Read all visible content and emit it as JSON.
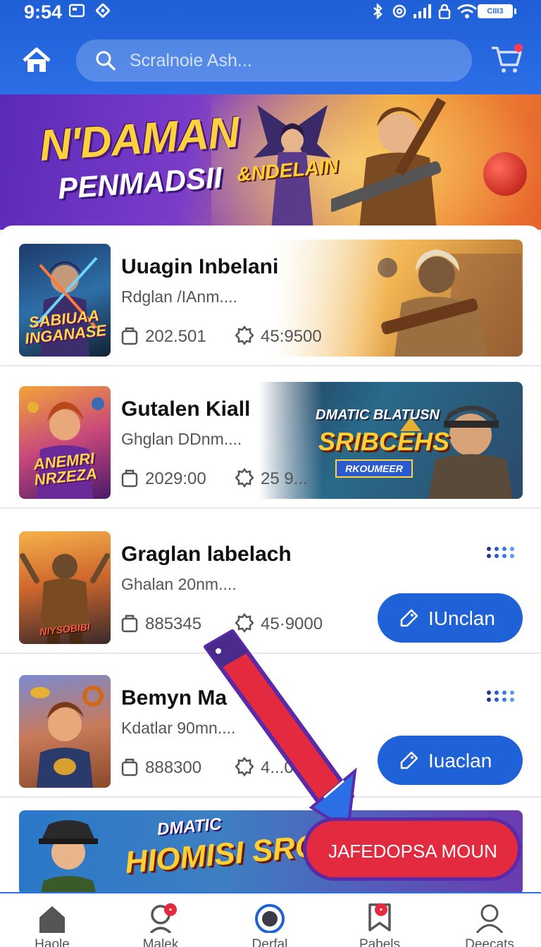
{
  "status_bar": {
    "time": "9:54",
    "battery": "CIII3"
  },
  "search": {
    "placeholder": "Scralnoie Ash..."
  },
  "banner": {
    "title_line1": "N'DAMAN",
    "title_line2": "PENMADSII",
    "badge": "&NDELAIN"
  },
  "items": [
    {
      "title": "Uuagin Inbelani",
      "subtitle": "Rdglan /IAnm....",
      "meta1": "202.501",
      "meta2": "45:9500",
      "thumb_label": "SABIUAA INGANASE"
    },
    {
      "title": "Gutalen Kiall",
      "subtitle": "Ghglan DDnm....",
      "meta1": "2029:00",
      "meta2": "25 9...",
      "thumb_label": "ANEMRI NRZEZA",
      "promo_title": "SRIBCEHS",
      "promo_top": "DMATIC BLATUSN",
      "promo_ribbon": "RKOUMEER"
    },
    {
      "title": "Graglan labelach",
      "subtitle": "Ghalan 20nm....",
      "meta1": "885345",
      "meta2": "45·9000",
      "thumb_label": "NIYSOBIBI",
      "action": "IUnclan"
    },
    {
      "title": "Bemyn Ma",
      "subtitle": "Kdatlar 90mn....",
      "meta1": "888300",
      "meta2": "4...0",
      "action": "Iuaclan"
    }
  ],
  "bottom_banner": {
    "top": "DMATIC",
    "title": "HIOMISI SROHHS"
  },
  "callout": {
    "label": "JAFEDOPSA MOUN"
  },
  "bottom_nav": [
    {
      "label": "Haole",
      "icon": "home-icon"
    },
    {
      "label": "Malek",
      "icon": "person-alert-icon",
      "badge": "•"
    },
    {
      "label": "Derfal",
      "icon": "target-icon"
    },
    {
      "label": "Pabels",
      "icon": "flag-icon",
      "badge": "•"
    },
    {
      "label": "Deecats",
      "icon": "profile-icon"
    }
  ],
  "colors": {
    "primary": "#2b6ee6",
    "accent": "#e42a3e",
    "button": "#1f62d8"
  }
}
